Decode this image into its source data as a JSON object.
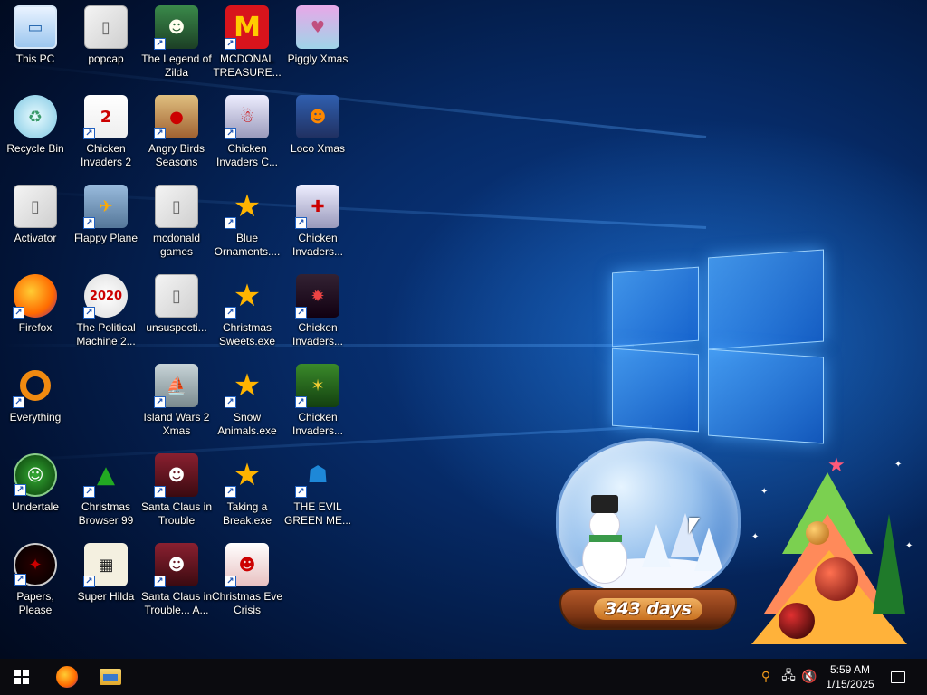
{
  "desktop": {
    "icons": [
      {
        "label": "This PC",
        "glyph": "▭",
        "icon": "this-pc-icon",
        "shortcut": false
      },
      {
        "label": "Recycle Bin",
        "glyph": "♻",
        "icon": "recycle-bin-icon",
        "shortcut": false
      },
      {
        "label": "Activator",
        "glyph": "▯",
        "icon": "folder-icon",
        "shortcut": false
      },
      {
        "label": "Firefox",
        "glyph": "",
        "icon": "firefox-icon",
        "shortcut": true
      },
      {
        "label": "Everything",
        "glyph": "",
        "icon": "everything-search-icon",
        "shortcut": true
      },
      {
        "label": "Undertale",
        "glyph": "☺",
        "icon": "undertale-icon",
        "shortcut": true
      },
      {
        "label": "Papers, Please",
        "glyph": "✦",
        "icon": "papers-please-icon",
        "shortcut": true
      },
      {
        "label": "popcap",
        "glyph": "▯",
        "icon": "folder-icon",
        "shortcut": false
      },
      {
        "label": "Chicken Invaders 2",
        "glyph": "2",
        "icon": "chicken-invaders-2-icon",
        "shortcut": true
      },
      {
        "label": "Flappy Plane",
        "glyph": "✈",
        "icon": "flappy-plane-icon",
        "shortcut": true
      },
      {
        "label": "The Political Machine 2...",
        "glyph": "2020",
        "icon": "political-machine-icon",
        "shortcut": true
      },
      {
        "label": "Christmas Browser 99",
        "glyph": "▲",
        "icon": "christmas-browser-icon",
        "shortcut": true
      },
      {
        "label": "Super Hilda",
        "glyph": "▦",
        "icon": "super-hilda-icon",
        "shortcut": true
      },
      {
        "label": "The Legend of Zilda",
        "glyph": "☻",
        "icon": "legend-of-zilda-icon",
        "shortcut": true
      },
      {
        "label": "Angry Birds Seasons",
        "glyph": "●",
        "icon": "angry-birds-icon",
        "shortcut": true
      },
      {
        "label": "mcdonald games",
        "glyph": "▯",
        "icon": "folder-icon",
        "shortcut": false
      },
      {
        "label": "unsuspecti...",
        "glyph": "▯",
        "icon": "folder-icon",
        "shortcut": false
      },
      {
        "label": "Island Wars 2 Xmas",
        "glyph": "⛵",
        "icon": "island-wars-icon",
        "shortcut": true
      },
      {
        "label": "Santa Claus in Trouble",
        "glyph": "☻",
        "icon": "santa-claus-icon",
        "shortcut": true
      },
      {
        "label": "Santa Claus in Trouble... A...",
        "glyph": "☻",
        "icon": "santa-claus-icon",
        "shortcut": true
      },
      {
        "label": "MCDONAL TREASURE...",
        "glyph": "M",
        "icon": "mcdonalds-icon",
        "shortcut": true
      },
      {
        "label": "Chicken Invaders C...",
        "glyph": "☃",
        "icon": "chicken-invaders-christmas-icon",
        "shortcut": true
      },
      {
        "label": "Blue Ornaments....",
        "glyph": "★",
        "icon": "star-exe-icon",
        "shortcut": true
      },
      {
        "label": "Christmas Sweets.exe",
        "glyph": "★",
        "icon": "star-exe-icon",
        "shortcut": true
      },
      {
        "label": "Snow Animals.exe",
        "glyph": "★",
        "icon": "star-exe-icon",
        "shortcut": true
      },
      {
        "label": "Taking a Break.exe",
        "glyph": "★",
        "icon": "star-exe-icon",
        "shortcut": true
      },
      {
        "label": "Christmas Eve Crisis",
        "glyph": "☻",
        "icon": "santa-face-icon",
        "shortcut": true
      },
      {
        "label": "Piggly Xmas",
        "glyph": "♥",
        "icon": "piggly-xmas-icon",
        "shortcut": false
      },
      {
        "label": "Loco Xmas",
        "glyph": "☻",
        "icon": "loco-xmas-icon",
        "shortcut": false
      },
      {
        "label": "Chicken Invaders...",
        "glyph": "✚",
        "icon": "chicken-invaders-icon",
        "shortcut": true
      },
      {
        "label": "Chicken Invaders...",
        "glyph": "✹",
        "icon": "chicken-invaders-icon",
        "shortcut": true
      },
      {
        "label": "Chicken Invaders...",
        "glyph": "✶",
        "icon": "chicken-invaders-icon",
        "shortcut": true
      },
      {
        "label": "THE EVIL GREEN ME...",
        "glyph": "☗",
        "icon": "evil-green-me-icon",
        "shortcut": true
      }
    ]
  },
  "widgets": {
    "snowglobe_counter": "343 days"
  },
  "taskbar": {
    "pinned": [
      "Start",
      "Firefox",
      "File Explorer"
    ],
    "tray": {
      "icons": [
        "search-tray-icon",
        "network-icon",
        "volume-muted-icon"
      ]
    },
    "clock": {
      "time": "5:59 AM",
      "date": "1/15/2025"
    }
  },
  "colors": {
    "taskbar_bg": "#0b0b0f",
    "desktop_bg": "#062a66",
    "label_text": "#ffffff"
  }
}
